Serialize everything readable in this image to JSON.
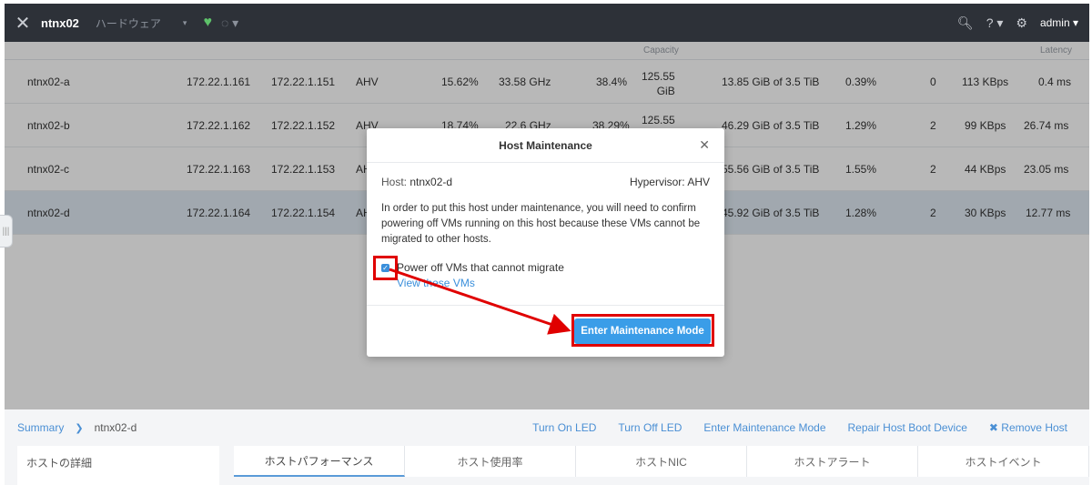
{
  "topbar": {
    "cluster": "ntnx02",
    "menu": "ハードウェア",
    "user": "admin",
    "icons": [
      "logo-x-icon",
      "chevron-down-icon",
      "heart-health-icon",
      "spinner-icon",
      "search-icon",
      "help-icon",
      "gear-icon"
    ]
  },
  "table": {
    "header_partial": {
      "capacity": "Capacity",
      "latency": "Latency"
    },
    "rows": [
      {
        "name": "ntnx02-a",
        "ip1": "172.22.1.161",
        "ip2": "172.22.1.151",
        "hyp": "AHV",
        "cpu_pct": "15.62%",
        "cpu_ghz": "33.58 GHz",
        "mem_pct": "38.4%",
        "mem_cap_1": "125.55",
        "mem_cap_2": "GiB",
        "storage": "13.85 GiB of 3.5 TiB",
        "disk_pct": "0.39%",
        "vms": "0",
        "io": "113 KBps",
        "lat": "0.4 ms"
      },
      {
        "name": "ntnx02-b",
        "ip1": "172.22.1.162",
        "ip2": "172.22.1.152",
        "hyp": "AHV",
        "cpu_pct": "18.74%",
        "cpu_ghz": "22.6 GHz",
        "mem_pct": "38.29%",
        "mem_cap_1": "125.55",
        "mem_cap_2": "",
        "storage": "46.29 GiB of 3.5 TiB",
        "disk_pct": "1.29%",
        "vms": "2",
        "io": "99 KBps",
        "lat": "26.74 ms"
      },
      {
        "name": "ntnx02-c",
        "ip1": "172.22.1.163",
        "ip2": "172.22.1.153",
        "hyp": "AH",
        "cpu_pct": "",
        "cpu_ghz": "",
        "mem_pct": "",
        "mem_cap_1": "",
        "mem_cap_2": "",
        "storage": "55.56 GiB of 3.5 TiB",
        "disk_pct": "1.55%",
        "vms": "2",
        "io": "44 KBps",
        "lat": "23.05 ms"
      },
      {
        "name": "ntnx02-d",
        "ip1": "172.22.1.164",
        "ip2": "172.22.1.154",
        "hyp": "AH",
        "cpu_pct": "",
        "cpu_ghz": "",
        "mem_pct": "",
        "mem_cap_1": "",
        "mem_cap_2": "",
        "storage": "45.92 GiB of 3.5 TiB",
        "disk_pct": "1.28%",
        "vms": "2",
        "io": "30 KBps",
        "lat": "12.77 ms"
      }
    ]
  },
  "summary": {
    "crumb_root": "Summary",
    "crumb_host": "ntnx02-d",
    "actions": [
      "Turn On LED",
      "Turn Off LED",
      "Enter Maintenance Mode",
      "Repair Host Boot Device"
    ],
    "remove": "Remove Host"
  },
  "bottom": {
    "host_detail": "ホストの詳細",
    "tabs": [
      "ホストパフォーマンス",
      "ホスト使用率",
      "ホストNIC",
      "ホストアラート",
      "ホストイベント"
    ]
  },
  "modal": {
    "title": "Host Maintenance",
    "host_label": "Host:",
    "host_value": "ntnx02-d",
    "hyp_label": "Hypervisor:",
    "hyp_value": "AHV",
    "message": "In order to put this host under maintenance, you will need to confirm powering off VMs running on this host because these VMs cannot be migrated to other hosts.",
    "checkbox_label": "Power off VMs that cannot migrate",
    "checkbox_checked": true,
    "view_vms": "View these VMs",
    "primary_button": "Enter Maintenance Mode"
  },
  "colors": {
    "topbar": "#2d3138",
    "accent": "#3a9de8",
    "annotation": "#e00000",
    "health": "#5ec26a"
  }
}
